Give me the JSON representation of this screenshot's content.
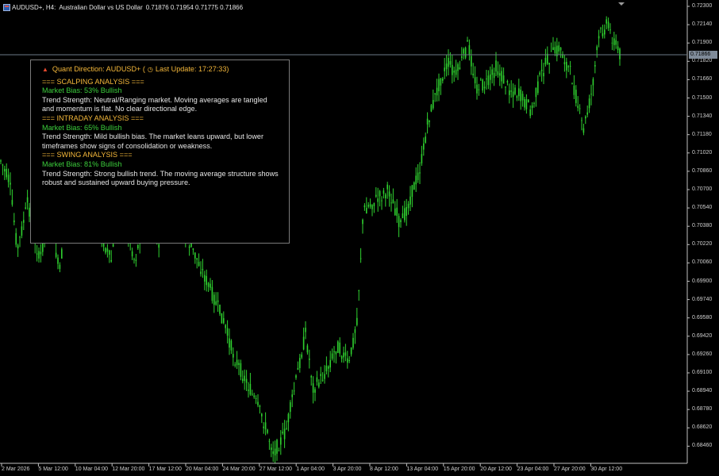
{
  "title_bar": {
    "symbol": "AUDUSD+, H4:",
    "description": "Australian Dollar vs US Dollar",
    "ohlc": "0.71876 0.71954 0.71775 0.71866"
  },
  "current_price": "0.71866",
  "price_axis": [
    "0.72300",
    "0.72140",
    "0.71900",
    "0.71820",
    "0.71660",
    "0.71500",
    "0.71340",
    "0.71180",
    "0.71020",
    "0.70860",
    "0.70700",
    "0.70540",
    "0.70380",
    "0.70220",
    "0.70060",
    "0.69900",
    "0.69740",
    "0.69580",
    "0.69420",
    "0.69260",
    "0.69100",
    "0.68940",
    "0.68780",
    "0.68620",
    "0.68460"
  ],
  "time_axis": [
    "2 Mar 2026",
    "5 Mar 12:00",
    "10 Mar 04:00",
    "12 Mar 20:00",
    "17 Mar 12:00",
    "20 Mar 04:00",
    "24 Mar 20:00",
    "27 Mar 12:00",
    "1 Apr 04:00",
    "3 Apr 20:00",
    "8 Apr 12:00",
    "13 Apr 04:00",
    "15 Apr 20:00",
    "20 Apr 12:00",
    "23 Apr 04:00",
    "27 Apr 20:00",
    "30 Apr 12:00"
  ],
  "panel": {
    "header_left": "Quant Direction: AUDUSD+ (",
    "header_right": "Last Update: 17:27:33)",
    "flame_icon": "flame-icon",
    "clock_icon": "clock-icon",
    "sections": [
      {
        "heading": "=== SCALPING ANALYSIS ===",
        "bias": "Market Bias: 53% Bullish",
        "text": "Trend Strength: Neutral/Ranging market. Moving averages are tangled and momentum is flat. No clear directional edge."
      },
      {
        "heading": "=== INTRADAY ANALYSIS ===",
        "bias": "Market Bias: 65% Bullish",
        "text": "Trend Strength: Mild bullish bias. The market leans upward, but lower timeframes show signs of consolidation or weakness."
      },
      {
        "heading": "=== SWING ANALYSIS ===",
        "bias": "Market Bias: 81% Bullish",
        "text": "Trend Strength: Strong bullish trend. The moving average structure shows robust and sustained upward buying pressure."
      }
    ]
  },
  "colors": {
    "background": "#000000",
    "candle": "#2fd12f",
    "panel_heading": "#f5b83a",
    "panel_bias": "#3ccf3c",
    "axis_text": "#cfcfcf"
  }
}
